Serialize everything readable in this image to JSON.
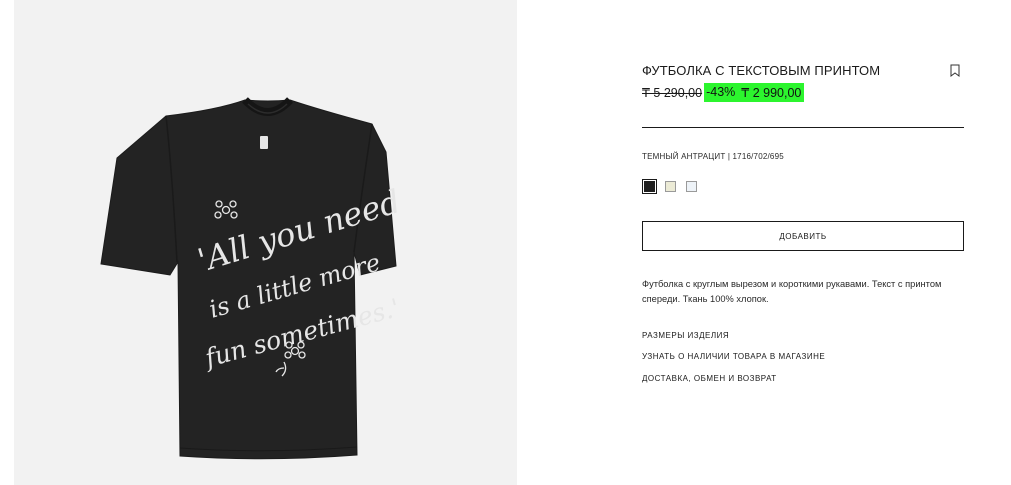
{
  "product": {
    "title": "ФУТБОЛКА С ТЕКСТОВЫМ ПРИНТОМ",
    "old_price": "₸ 5 290,00",
    "discount": "-43%",
    "new_price": "₸ 2 990,00",
    "color_label": "ТЕМНЫЙ АНТРАЦИТ | 1716/702/695",
    "swatches": [
      {
        "name": "dark-anthracite",
        "color": "#1f1f1f",
        "selected": true
      },
      {
        "name": "beige",
        "color": "#ecebd6",
        "selected": false
      },
      {
        "name": "light-blue",
        "color": "#eef3f8",
        "selected": false
      }
    ],
    "add_button": "ДОБАВИТЬ",
    "description": "Футболка с круглым вырезом и короткими рукавами. Текст с принтом спереди. Ткань 100% хлопок."
  },
  "links": {
    "sizes": "РАЗМЕРЫ ИЗДЕЛИЯ",
    "availability": "УЗНАТЬ О НАЛИЧИИ ТОВАРА В МАГАЗИНЕ",
    "delivery": "ДОСТАВКА, ОБМЕН И ВОЗВРАТ"
  },
  "image": {
    "print_lines": [
      "'All you need",
      "is a little more",
      "fun sometimes.'"
    ]
  },
  "colors": {
    "sale_highlight": "#2cf52e",
    "photo_background": "#f2f2f2",
    "shirt": "#232323"
  }
}
